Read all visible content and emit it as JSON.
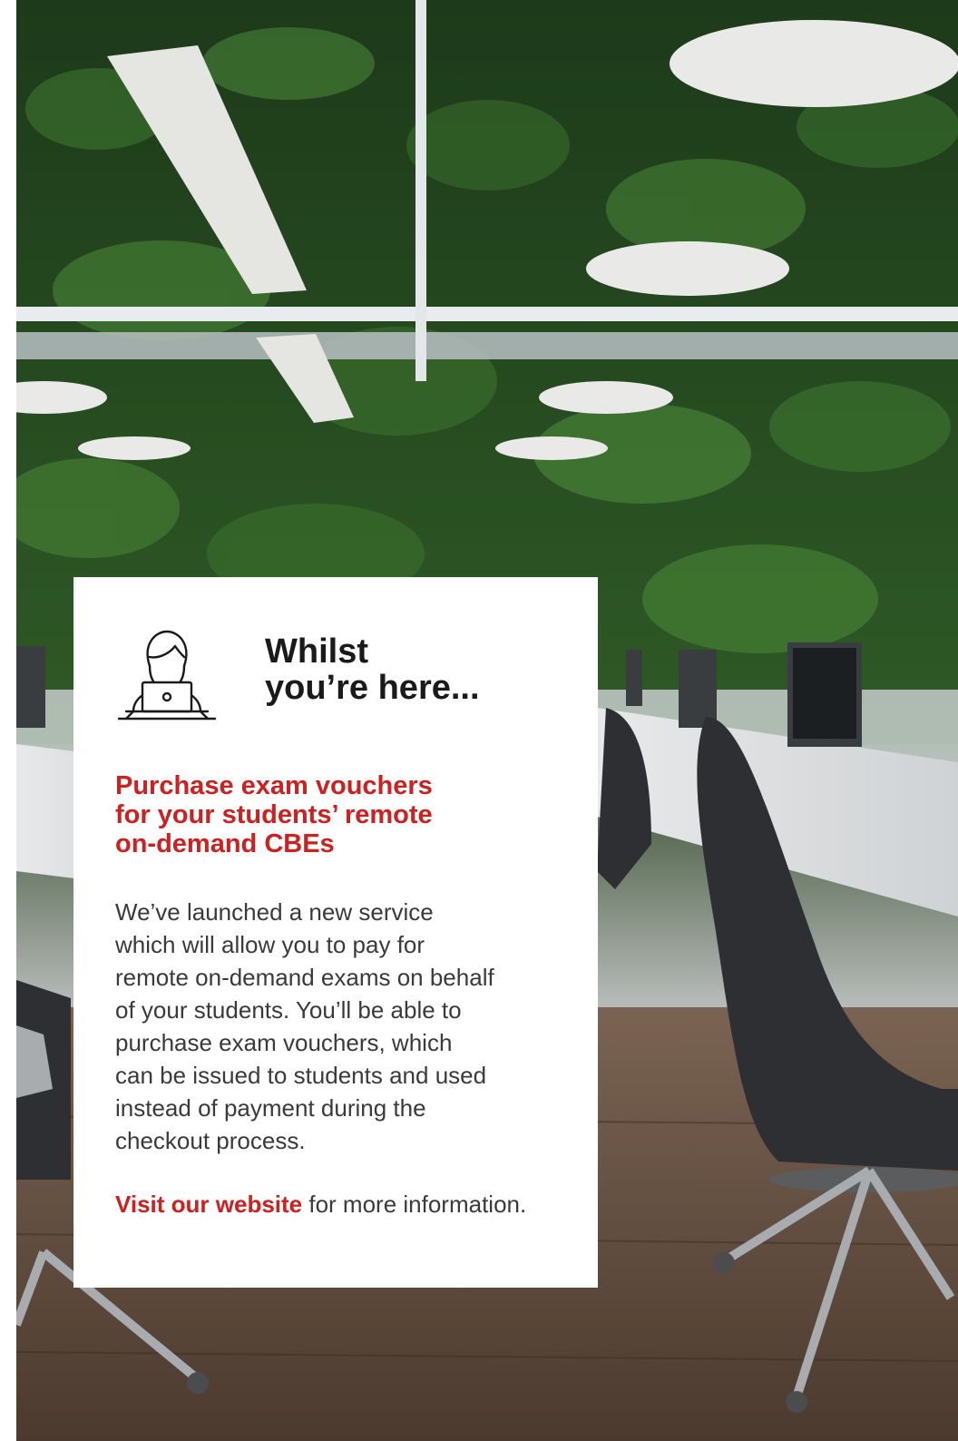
{
  "card": {
    "heading_line1": "Whilst",
    "heading_line2": "you’re here...",
    "subheading_lines": [
      "Purchase exam vouchers",
      "for your students’ remote",
      "on-demand CBEs"
    ],
    "body_lines": [
      "We’ve launched a new service",
      "which will allow you to pay for",
      "remote on-demand exams on behalf",
      "of your students. You’ll be able to",
      "purchase exam vouchers, which",
      "can be issued to students and used",
      "instead of payment during the",
      "checkout process."
    ],
    "cta_link_label": "Visit our website",
    "cta_rest": " for more information.",
    "icon": "person-at-laptop-icon"
  },
  "background": {
    "image": "office-with-green-plant-wall-photo"
  },
  "colors": {
    "accent": "#d01f1f",
    "heading": "#1a1a1a",
    "body": "#3a3a3a"
  }
}
